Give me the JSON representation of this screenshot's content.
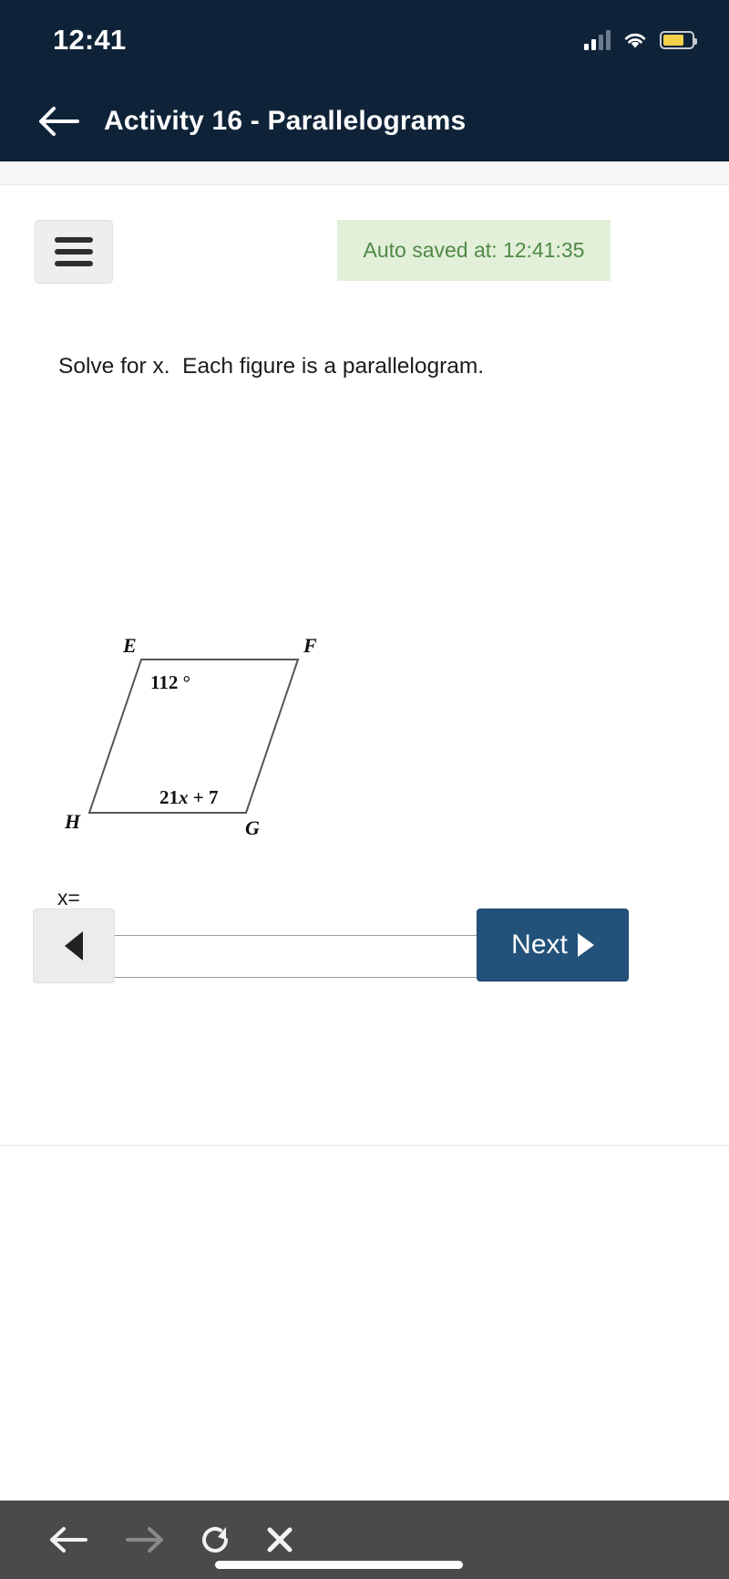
{
  "status_bar": {
    "time": "12:41",
    "icons": [
      "signal-bars-icon",
      "wifi-icon",
      "battery-icon"
    ],
    "battery_color": "#f5d14a",
    "battery_level_pct": 72
  },
  "app_bar": {
    "back_icon": "arrow-left-icon",
    "title": "Activity 16 - Parallelograms",
    "background": "#0f2338"
  },
  "toolbar": {
    "menu_icon": "hamburger-menu-icon",
    "autosave_text": "Auto saved at: 12:41:35",
    "autosave_bg": "#e2efd9",
    "autosave_color": "#4f8a45"
  },
  "question": {
    "prompt": "Solve for x.  Each figure is a parallelogram.",
    "answer_label": "x=",
    "answer_value": "",
    "answer_placeholder": ""
  },
  "figure": {
    "type": "parallelogram",
    "vertices": [
      "E",
      "F",
      "G",
      "H"
    ],
    "vertex_labels": {
      "E": "E",
      "F": "F",
      "G": "G",
      "H": "H"
    },
    "angle_label": "112 °",
    "angle_value": 112,
    "side_label": "21x + 7",
    "side_expression_parts": {
      "coefficient": "21",
      "variable": "x",
      "operator": "+",
      "constant": "7"
    },
    "stroke_color": "#555555"
  },
  "navigation": {
    "prev_icon": "triangle-left-icon",
    "next_label": "Next",
    "next_icon": "triangle-right-icon",
    "next_bg": "#225179"
  },
  "browser_bar": {
    "background": "#4a4a4a",
    "buttons": [
      {
        "name": "browser-back",
        "icon": "arrow-left-icon",
        "enabled": true
      },
      {
        "name": "browser-forward",
        "icon": "arrow-right-icon",
        "enabled": false
      },
      {
        "name": "browser-reload",
        "icon": "reload-icon",
        "enabled": true
      },
      {
        "name": "browser-stop",
        "icon": "close-x-icon",
        "enabled": true
      }
    ]
  }
}
